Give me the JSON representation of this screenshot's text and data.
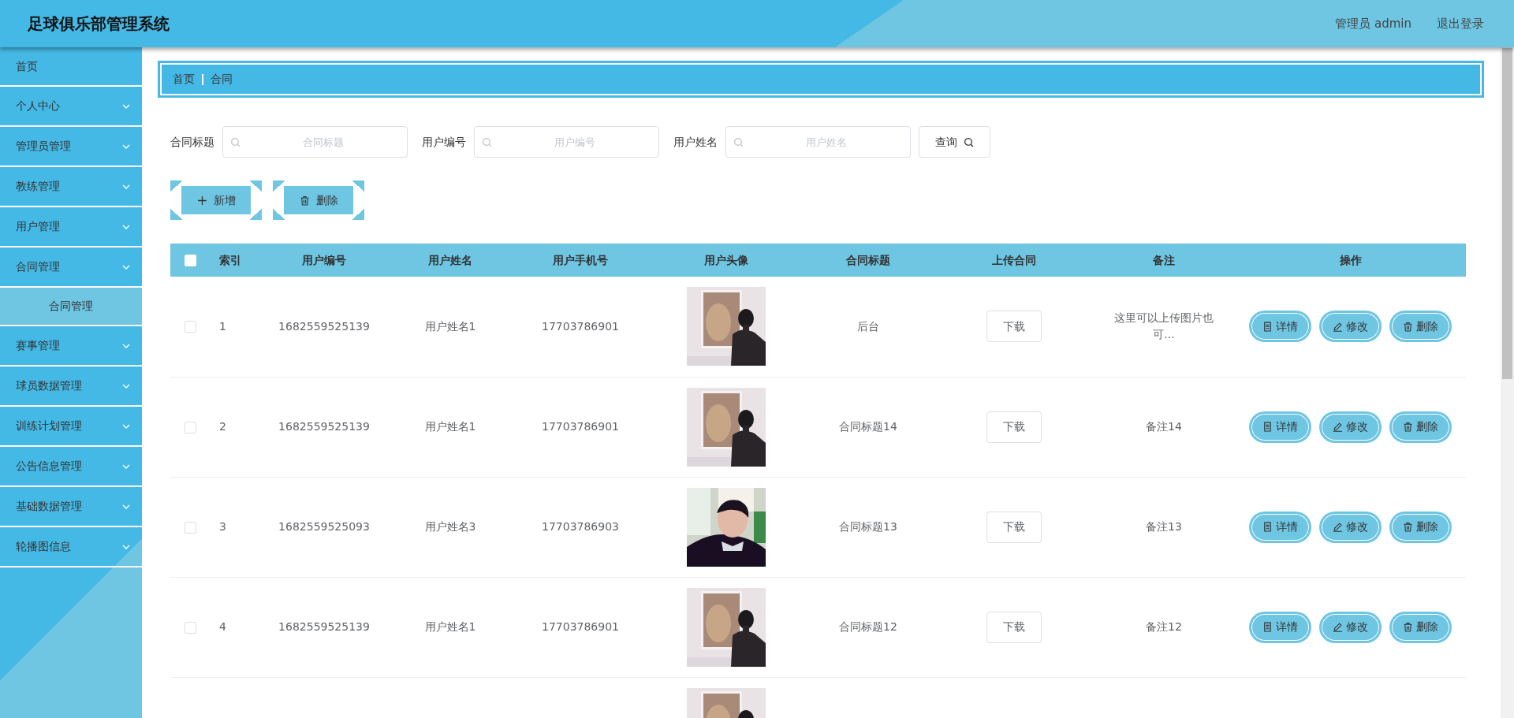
{
  "header": {
    "title": "足球俱乐部管理系统",
    "user": "管理员 admin",
    "logout": "退出登录"
  },
  "sidebar": {
    "items": [
      {
        "label": "首页",
        "kind": "link"
      },
      {
        "label": "个人中心",
        "kind": "menu"
      },
      {
        "label": "管理员管理",
        "kind": "menu"
      },
      {
        "label": "教练管理",
        "kind": "menu"
      },
      {
        "label": "用户管理",
        "kind": "menu"
      },
      {
        "label": "合同管理",
        "kind": "menu",
        "children": [
          {
            "label": "合同管理",
            "selected": true
          }
        ]
      },
      {
        "label": "赛事管理",
        "kind": "menu"
      },
      {
        "label": "球员数据管理",
        "kind": "menu"
      },
      {
        "label": "训练计划管理",
        "kind": "menu"
      },
      {
        "label": "公告信息管理",
        "kind": "menu"
      },
      {
        "label": "基础数据管理",
        "kind": "menu"
      },
      {
        "label": "轮播图信息",
        "kind": "menu"
      }
    ]
  },
  "breadcrumb": [
    "首页",
    "合同"
  ],
  "search": {
    "fields": [
      {
        "label": "合同标题",
        "placeholder": "合同标题"
      },
      {
        "label": "用户编号",
        "placeholder": "用户编号"
      },
      {
        "label": "用户姓名",
        "placeholder": "用户姓名"
      }
    ],
    "button": "查询"
  },
  "toolbar": [
    {
      "label": "新增",
      "kind": "add"
    },
    {
      "label": "删除",
      "kind": "delete"
    }
  ],
  "table": {
    "select_all": {
      "checked": false
    },
    "columns": [
      "索引",
      "用户编号",
      "用户姓名",
      "用户手机号",
      "用户头像",
      "合同标题",
      "上传合同",
      "备注",
      "操作"
    ],
    "rows": [
      {
        "checked": false,
        "index": "1",
        "user_no": "1682559525139",
        "user_name": "用户姓名1",
        "phone": "17703786901",
        "avatar": {
          "kind": "picture"
        },
        "title": "后台",
        "upload": "下载",
        "note": "这里可以上传图片也可...",
        "actions": [
          {
            "label": "详情",
            "kind": "detail"
          },
          {
            "label": "修改",
            "kind": "edit"
          },
          {
            "label": "删除",
            "kind": "delete"
          }
        ]
      },
      {
        "checked": false,
        "index": "2",
        "user_no": "1682559525139",
        "user_name": "用户姓名1",
        "phone": "17703786901",
        "avatar": {
          "kind": "picture"
        },
        "title": "合同标题14",
        "upload": "下载",
        "note": "备注14",
        "actions": [
          {
            "label": "详情",
            "kind": "detail"
          },
          {
            "label": "修改",
            "kind": "edit"
          },
          {
            "label": "删除",
            "kind": "delete"
          }
        ]
      },
      {
        "checked": false,
        "index": "3",
        "user_no": "1682559525093",
        "user_name": "用户姓名3",
        "phone": "17703786903",
        "avatar": {
          "kind": "picture"
        },
        "title": "合同标题13",
        "upload": "下载",
        "note": "备注13",
        "actions": [
          {
            "label": "详情",
            "kind": "detail"
          },
          {
            "label": "修改",
            "kind": "edit"
          },
          {
            "label": "删除",
            "kind": "delete"
          }
        ]
      },
      {
        "checked": false,
        "index": "4",
        "user_no": "1682559525139",
        "user_name": "用户姓名1",
        "phone": "17703786901",
        "avatar": {
          "kind": "picture"
        },
        "title": "合同标题12",
        "upload": "下载",
        "note": "备注12",
        "actions": [
          {
            "label": "详情",
            "kind": "detail"
          },
          {
            "label": "修改",
            "kind": "edit"
          },
          {
            "label": "删除",
            "kind": "delete"
          }
        ]
      },
      {
        "avatar": {
          "kind": "picture"
        }
      }
    ]
  }
}
